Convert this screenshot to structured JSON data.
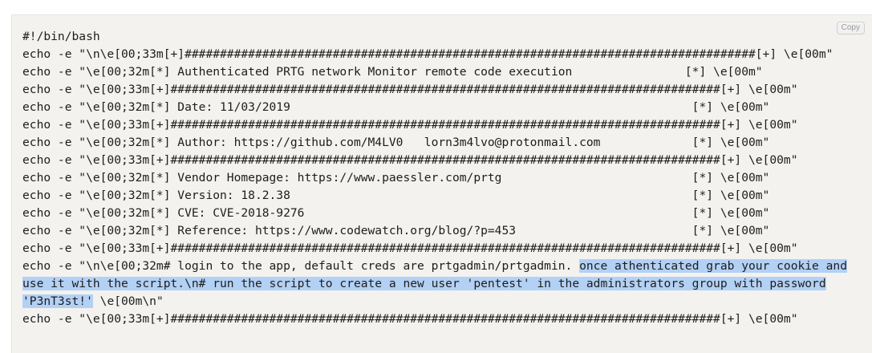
{
  "copy_button": {
    "label": "Copy"
  },
  "code": {
    "lines": [
      "#!/bin/bash",
      "echo -e \"\\n\\e[00;33m[+]#################################################################################[+] \\e[00m\"",
      "echo -e \"\\e[00;32m[*] Authenticated PRTG network Monitor remote code execution                [*] \\e[00m\"",
      "echo -e \"\\e[00;33m[+]##############################################################################[+] \\e[00m\"",
      "echo -e \"\\e[00;32m[*] Date: 11/03/2019                                                         [*] \\e[00m\"",
      "echo -e \"\\e[00;33m[+]##############################################################################[+] \\e[00m\"",
      "echo -e \"\\e[00;32m[*] Author: https://github.com/M4LV0   lorn3m4lvo@protonmail.com             [*] \\e[00m\"",
      "echo -e \"\\e[00;33m[+]##############################################################################[+] \\e[00m\"",
      "echo -e \"\\e[00;32m[*] Vendor Homepage: https://www.paessler.com/prtg                           [*] \\e[00m\"",
      "echo -e \"\\e[00;32m[*] Version: 18.2.38                                                         [*] \\e[00m\"",
      "echo -e \"\\e[00;32m[*] CVE: CVE-2018-9276                                                       [*] \\e[00m\"",
      "echo -e \"\\e[00;32m[*] Reference: https://www.codewatch.org/blog/?p=453                         [*] \\e[00m\"",
      "echo -e \"\\e[00;33m[+]##############################################################################[+] \\e[00m\""
    ],
    "long_line_plain": "echo -e \"\\n\\e[00;32m# login to the app, default creds are prtgadmin/prtgadmin. ",
    "long_line_selected_1": "once athenticated grab your cookie and",
    "long_line_selected_2": "use it with the script.\\n# run the script to create a new user 'pentest' in the administrators group with password",
    "long_line_selected_3": "'P3nT3st!'",
    "long_line_tail": " \\e[00m\\n\"",
    "last_line": "echo -e \"\\e[00;33m[+]##############################################################################[+] \\e[00m\""
  }
}
